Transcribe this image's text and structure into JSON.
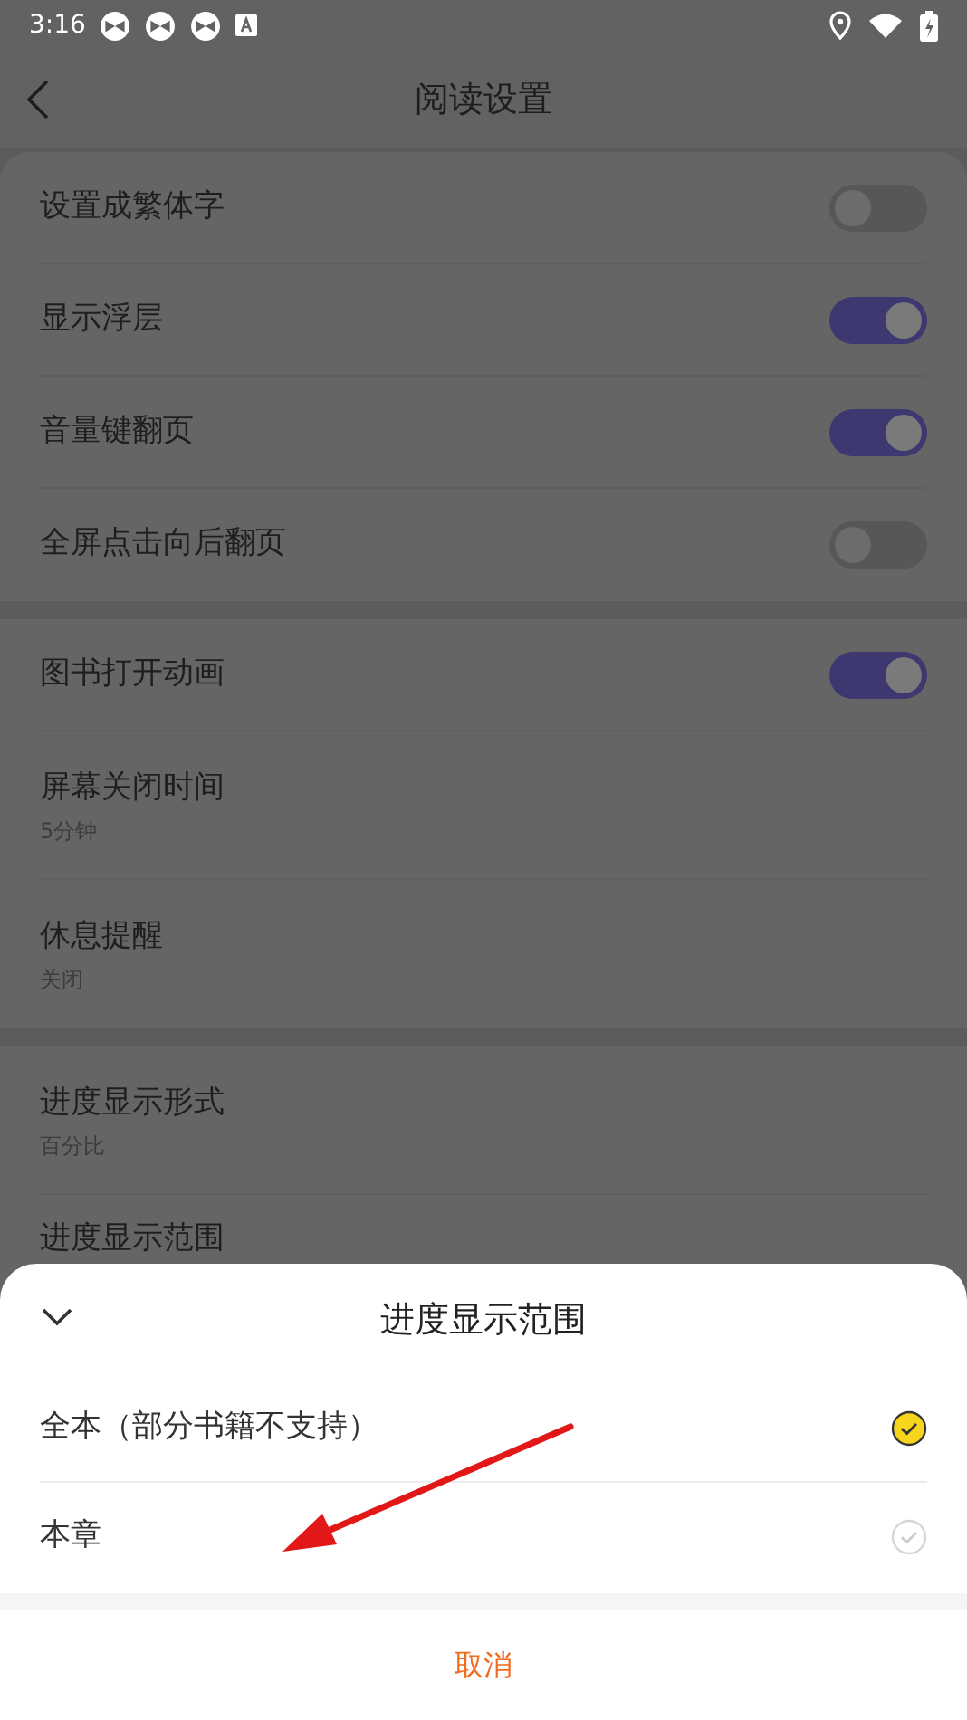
{
  "status_bar": {
    "time": "3:16"
  },
  "header": {
    "title": "阅读设置"
  },
  "groups": [
    {
      "items": [
        {
          "kind": "toggle",
          "label": "设置成繁体字",
          "on": false
        },
        {
          "kind": "toggle",
          "label": "显示浮层",
          "on": true
        },
        {
          "kind": "toggle",
          "label": "音量键翻页",
          "on": true
        },
        {
          "kind": "toggle",
          "label": "全屏点击向后翻页",
          "on": false
        }
      ]
    },
    {
      "items": [
        {
          "kind": "toggle",
          "label": "图书打开动画",
          "on": true
        },
        {
          "kind": "value",
          "label": "屏幕关闭时间",
          "value": "5分钟"
        },
        {
          "kind": "value",
          "label": "休息提醒",
          "value": "关闭"
        }
      ]
    },
    {
      "items": [
        {
          "kind": "value",
          "label": "进度显示形式",
          "value": "百分比"
        },
        {
          "kind": "plain",
          "label": "进度显示范围"
        }
      ]
    }
  ],
  "sheet": {
    "title": "进度显示范围",
    "options": [
      {
        "label": "全本（部分书籍不支持）",
        "selected": true
      },
      {
        "label": "本章",
        "selected": false
      }
    ],
    "cancel": "取消"
  }
}
